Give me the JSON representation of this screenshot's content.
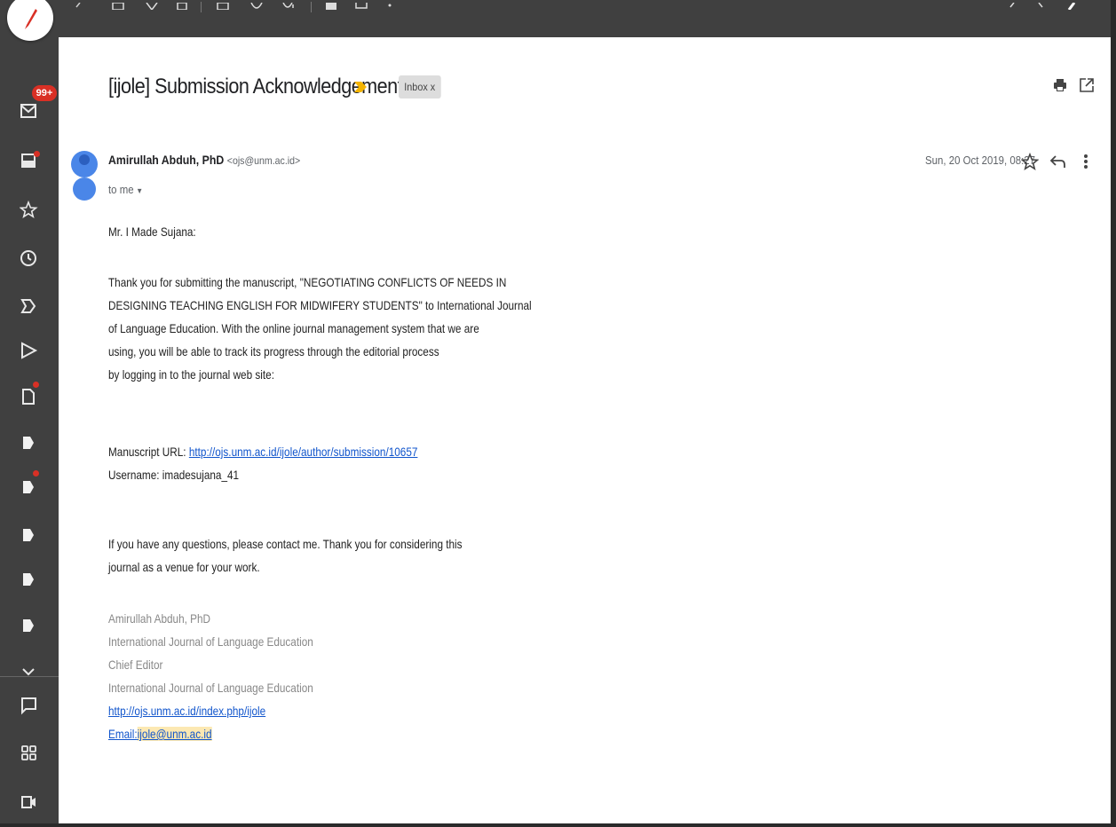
{
  "nav": {
    "inbox_badge": "99+"
  },
  "email": {
    "subject": "[ijole] Submission Acknowledgement",
    "label": "Inbox x",
    "sender_name": "Amirullah Abduh, PhD",
    "sender_email": "<ojs@unm.ac.id>",
    "recipient": "to me",
    "date": "Sun, 20 Oct 2019, 08:27",
    "greeting": "Mr. I Made Sujana:",
    "paragraph1": [
      "Thank you for submitting the manuscript, \"NEGOTIATING CONFLICTS OF NEEDS IN",
      "DESIGNING TEACHING ENGLISH FOR MIDWIFERY STUDENTS\" to International Journal",
      "of Language Education. With the online journal management system that we are",
      "using, you will be able to track its progress through the editorial process",
      "by logging in to the journal web site:"
    ],
    "manuscript_url_label": "Manuscript URL: ",
    "manuscript_url": "http://ojs.unm.ac.id/ijole/author/submission/10657",
    "username_line": "Username: imadesujana_41",
    "paragraph2": [
      "If you have any questions, please contact me. Thank you for considering this",
      "journal as a venue for your work."
    ],
    "signature": {
      "name": "Amirullah Abduh, PhD",
      "org1": "International Journal of Language Education",
      "role": "Chief Editor",
      "org2": "International Journal of Language Education",
      "site": "http://ojs.unm.ac.id/index.php/ijole",
      "email_label": "Email:",
      "email": "ijole@unm.ac.id"
    }
  },
  "colors": {
    "frame": "#404040",
    "badge": "#d93025",
    "link": "#1155cc",
    "importance": "#f4b400",
    "avatar": "#4a86e8"
  }
}
